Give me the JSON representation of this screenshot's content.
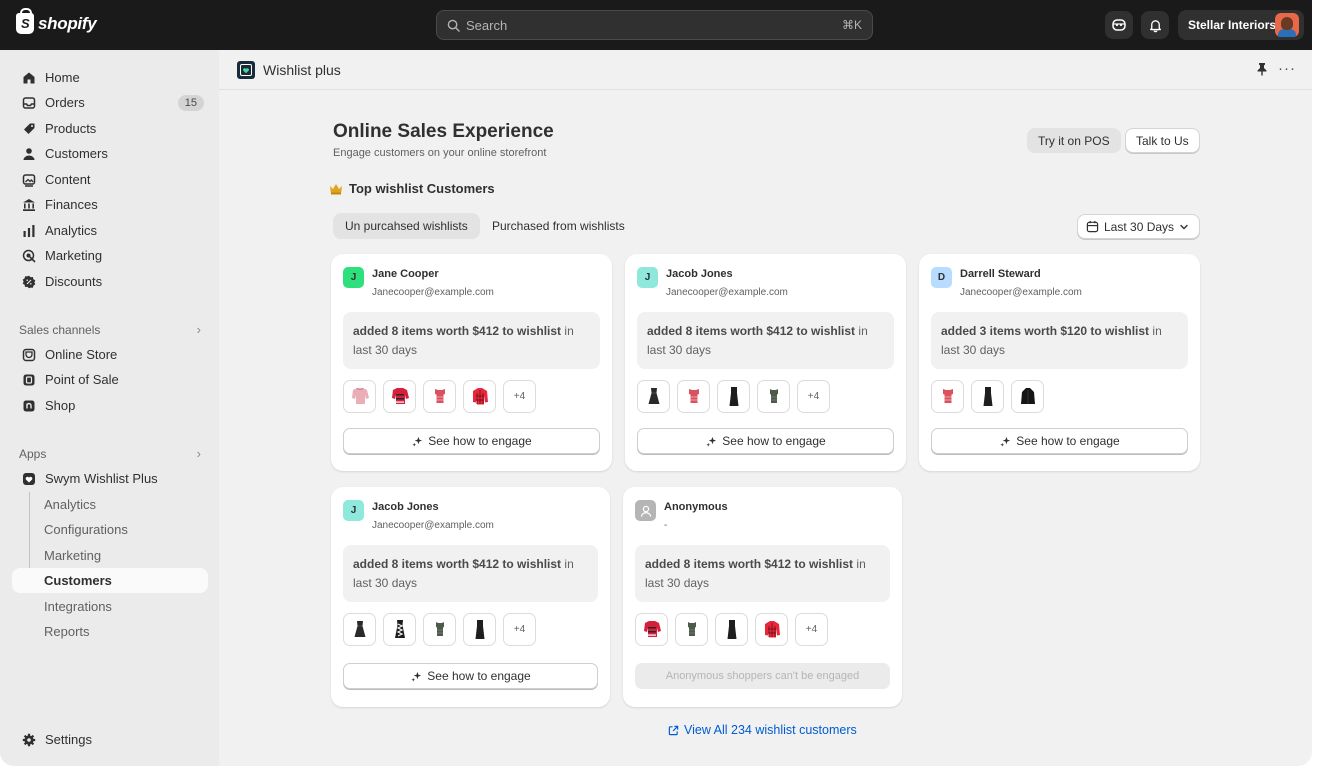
{
  "topbar": {
    "brand": "shopify",
    "search_placeholder": "Search",
    "search_shortcut": "⌘K",
    "store_name": "Stellar Interiors"
  },
  "sidebar": {
    "nav": [
      {
        "label": "Home",
        "icon": "home-icon"
      },
      {
        "label": "Orders",
        "icon": "inbox-icon",
        "badge": "15"
      },
      {
        "label": "Products",
        "icon": "tag-icon"
      },
      {
        "label": "Customers",
        "icon": "person-icon"
      },
      {
        "label": "Content",
        "icon": "image-icon"
      },
      {
        "label": "Finances",
        "icon": "bank-icon"
      },
      {
        "label": "Analytics",
        "icon": "bar-chart-icon"
      },
      {
        "label": "Marketing",
        "icon": "target-icon"
      },
      {
        "label": "Discounts",
        "icon": "discount-icon"
      }
    ],
    "sales_channels_label": "Sales channels",
    "sales_channels": [
      {
        "label": "Online Store",
        "icon": "store-icon"
      },
      {
        "label": "Point of Sale",
        "icon": "pos-icon"
      },
      {
        "label": "Shop",
        "icon": "shop-icon"
      }
    ],
    "apps_label": "Apps",
    "app_name": "Swym Wishlist Plus",
    "app_sub_items": [
      "Analytics",
      "Configurations",
      "Marketing",
      "Customers",
      "Integrations",
      "Reports"
    ],
    "active_sub_item": "Customers",
    "settings_label": "Settings"
  },
  "app_header": {
    "title": "Wishlist plus"
  },
  "page": {
    "title": "Online Sales Experience",
    "subtitle": "Engage customers on your online storefront",
    "try_pos_label": "Try it on POS",
    "talk_label": "Talk to Us",
    "section_title": "Top wishlist Customers",
    "tabs": [
      "Un purcahsed wishlists",
      "Purchased from wishlists"
    ],
    "selected_tab": 0,
    "date_range": "Last 30 Days",
    "view_all_label": "View All 234 wishlist customers"
  },
  "customers": [
    {
      "initial": "J",
      "name": "Jane Cooper",
      "email": "Janecooper@example.com",
      "avatar_color": "#2ee07b",
      "summary_bold": "added 8 items worth $412 to wishlist",
      "summary_rest": " in last 30 days",
      "products": [
        "sweater-pink",
        "sweater-red-stripe",
        "top-red",
        "jacket-red-check"
      ],
      "more": "+4",
      "engage_label": "See how to engage",
      "engageable": true
    },
    {
      "initial": "J",
      "name": "Jacob Jones",
      "email": "Janecooper@example.com",
      "avatar_color": "#8ee8dc",
      "summary_bold": "added 8 items worth $412 to wishlist",
      "summary_rest": " in last 30 days",
      "products": [
        "dress-black",
        "top-red",
        "dress-black-long",
        "top-green"
      ],
      "more": "+4",
      "engage_label": "See how to engage",
      "engageable": true
    },
    {
      "initial": "D",
      "name": "Darrell Steward",
      "email": "Janecooper@example.com",
      "avatar_color": "#b8dcff",
      "summary_bold": "added 3 items worth $120 to wishlist",
      "summary_rest": " in last 30 days",
      "products": [
        "top-red",
        "dress-black-long",
        "jacket-black"
      ],
      "more": "",
      "engage_label": "See how to engage",
      "engageable": true
    },
    {
      "initial": "J",
      "name": "Jacob Jones",
      "email": "Janecooper@example.com",
      "avatar_color": "#8ee8dc",
      "summary_bold": "added 8 items worth $412 to wishlist",
      "summary_rest": " in last 30 days",
      "products": [
        "dress-black",
        "dress-pattern",
        "top-green",
        "dress-black-long"
      ],
      "more": "+4",
      "engage_label": "See how to engage",
      "engageable": true
    },
    {
      "initial": "",
      "name": "Anonymous",
      "email": "-",
      "avatar_color": "#b5b5b5",
      "summary_bold": "added 8 items worth $412 to wishlist",
      "summary_rest": " in last 30 days",
      "products": [
        "sweater-red-stripe",
        "top-green",
        "dress-black-long",
        "jacket-red-check"
      ],
      "more": "+4",
      "engage_label": "Anonymous shoppers can't be engaged",
      "engageable": false
    }
  ],
  "colors": {
    "topbar_bg": "#1a1a1a",
    "sidebar_bg": "#ebebeb",
    "main_bg": "#f1f1f1",
    "link": "#005bd3"
  }
}
